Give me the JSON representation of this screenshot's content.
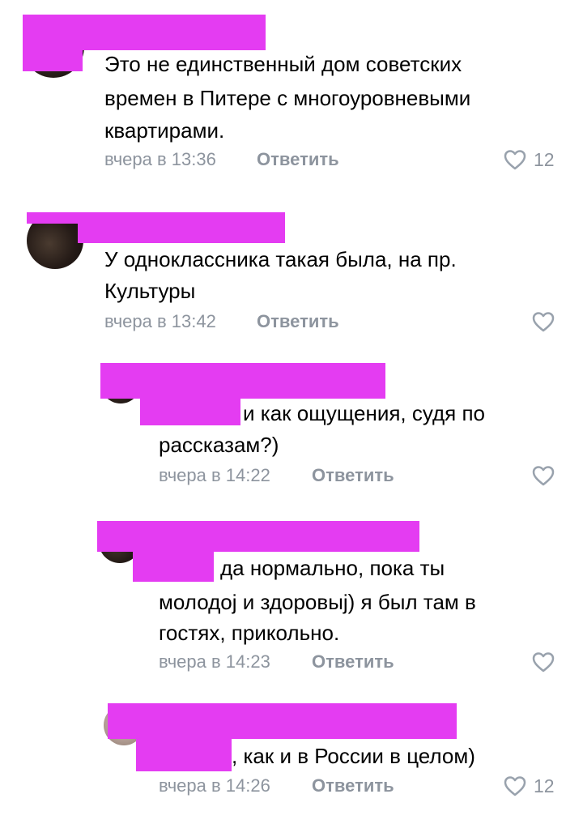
{
  "comments": [
    {
      "text_lines": [
        "Это не единственный дом советских",
        "времен в Питере с многоуровневыми",
        "квартирами."
      ],
      "time": "вчера в 13:36",
      "reply_label": "Ответить",
      "likes": "12"
    },
    {
      "text_lines": [
        "У одноклассника такая была, на пр.",
        "Культуры"
      ],
      "time": "вчера в 13:42",
      "reply_label": "Ответить",
      "likes": ""
    },
    {
      "text_lines": [
        "и как ощущения, судя по",
        "рассказам?)"
      ],
      "time": "вчера в 14:22",
      "reply_label": "Ответить",
      "likes": ""
    },
    {
      "text_lines": [
        "да нормально, пока ты",
        "молодој и здоровыј) я был там в",
        "гостях, прикольно."
      ],
      "time": "вчера в 14:23",
      "reply_label": "Ответить",
      "likes": ""
    },
    {
      "text_lines": [
        ", как и в России в целом)"
      ],
      "time": "вчера в 14:26",
      "reply_label": "Ответить",
      "likes": "12"
    }
  ],
  "colors": {
    "redaction": "#e43cf2",
    "meta": "#8d949e",
    "heart_outline": "#99a2ad"
  },
  "icons": {
    "like": "heart-outline-icon"
  }
}
